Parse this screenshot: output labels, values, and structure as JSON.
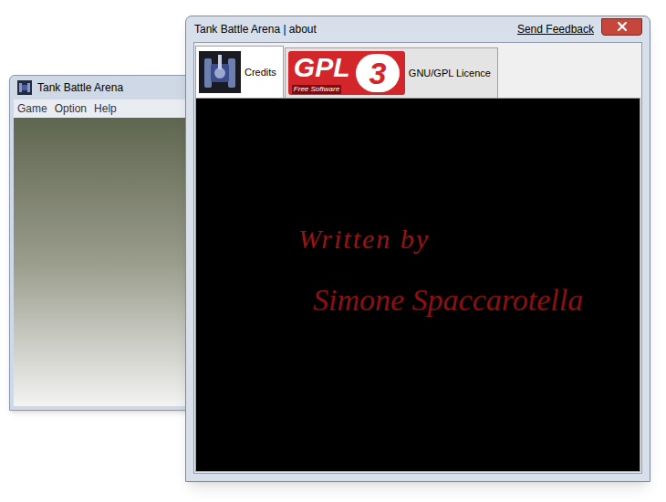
{
  "back_window": {
    "title": "Tank Battle Arena",
    "menu": [
      "Game",
      "Option",
      "Help"
    ]
  },
  "about_window": {
    "title": "Tank Battle Arena | about",
    "feedback_link": "Send Feedback",
    "tabs": [
      {
        "label": "Credits",
        "selected": true
      },
      {
        "label": "GNU/GPL Licence",
        "selected": false
      }
    ],
    "gpl_logo": {
      "text": "GPL",
      "subtitle": "Free Software",
      "version": "3"
    },
    "credits": {
      "heading": "Written by",
      "author": "Simone Spaccarotella"
    }
  }
}
